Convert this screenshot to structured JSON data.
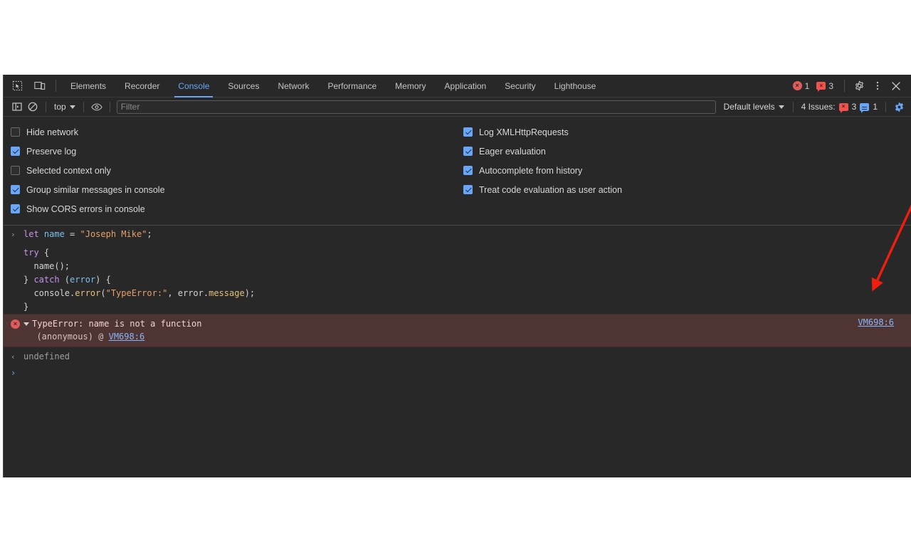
{
  "window": {
    "background": "#ffffff",
    "panel_background": "#282828"
  },
  "tabbar": {
    "inspect_icon": "inspect-element-icon",
    "device_icon": "device-toolbar-icon",
    "tabs": [
      {
        "label": "Elements",
        "active": false
      },
      {
        "label": "Recorder",
        "active": false
      },
      {
        "label": "Console",
        "active": true
      },
      {
        "label": "Sources",
        "active": false
      },
      {
        "label": "Network",
        "active": false
      },
      {
        "label": "Performance",
        "active": false
      },
      {
        "label": "Memory",
        "active": false
      },
      {
        "label": "Application",
        "active": false
      },
      {
        "label": "Security",
        "active": false
      },
      {
        "label": "Lighthouse",
        "active": false
      }
    ],
    "error_count": "1",
    "warning_count": "3",
    "error_glyph": "×",
    "warning_glyph": "×",
    "settings_icon": "gear-icon",
    "more_icon": "kebab-menu-icon",
    "close_icon": "close-icon",
    "accent_color": "#6aa6f8",
    "error_color": "#e05c5c"
  },
  "filterbar": {
    "sidebar_icon": "console-sidebar-toggle-icon",
    "clear_icon": "clear-console-icon",
    "context": "top",
    "eye_icon": "live-expression-eye-icon",
    "filter_value": "",
    "filter_placeholder": "Filter",
    "levels_label": "Default levels",
    "issues_label": "4 Issues:",
    "issues_error_count": "3",
    "issues_info_count": "1",
    "settings_gear_icon": "console-settings-gear-icon"
  },
  "settings": {
    "left": [
      {
        "label": "Hide network",
        "checked": false
      },
      {
        "label": "Preserve log",
        "checked": true
      },
      {
        "label": "Selected context only",
        "checked": false
      },
      {
        "label": "Group similar messages in console",
        "checked": true
      },
      {
        "label": "Show CORS errors in console",
        "checked": true
      }
    ],
    "right": [
      {
        "label": "Log XMLHttpRequests",
        "checked": true
      },
      {
        "label": "Eager evaluation",
        "checked": true
      },
      {
        "label": "Autocomplete from history",
        "checked": true
      },
      {
        "label": "Treat code evaluation as user action",
        "checked": true
      }
    ]
  },
  "console": {
    "input_prompt_glyph": "›",
    "result_prompt_glyph": "‹",
    "line1": {
      "kw_let": "let",
      "ident_name": " name",
      "eq": " = ",
      "string": "\"Joseph Mike\"",
      "semi": ";"
    },
    "block": {
      "try_kw": "try",
      "try_brace": " {",
      "call": "  name();",
      "catch_close": "} ",
      "catch_kw": "catch",
      "catch_paren_open": " (",
      "catch_err": "error",
      "catch_paren_close": ") {",
      "console_obj": "  console.",
      "console_method": "error",
      "console_open": "(",
      "console_str": "\"TypeError:\"",
      "console_comma": ", error.",
      "console_prop": "message",
      "console_close": ");",
      "end_brace": "}"
    },
    "error": {
      "icon": "error-circle-icon",
      "glyph": "×",
      "message": "TypeError: name is not a function",
      "stack_prefix": "  (anonymous) @ ",
      "stack_link": "VM698:6",
      "right_link": "VM698:6",
      "row_background": "#4e3534"
    },
    "result": "undefined"
  },
  "annotation": {
    "arrow_color": "#f01e0e",
    "description": "red-arrow-pointing-to-source-link"
  }
}
